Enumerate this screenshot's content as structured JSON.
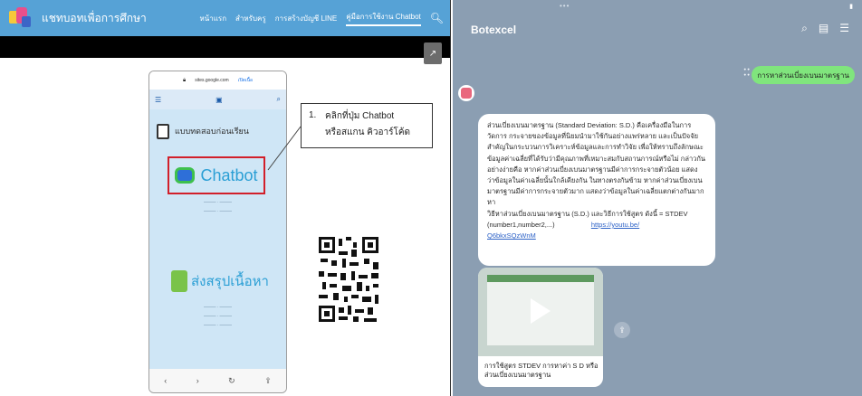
{
  "left": {
    "site": {
      "title": "แชทบอทเพื่อการศึกษา",
      "nav": [
        "หน้าแรก",
        "สำหรับครู",
        "การสร้างบัญชี LINE",
        "คู่มือการใช้งาน Chatbot"
      ],
      "search_icon": "search-icon",
      "open_icon": "external-link-icon"
    },
    "phone": {
      "url": "sites.google.com",
      "open_label": "เปิดเนื้อ",
      "quiz_label": "แบบทดสอบก่อนเรียน",
      "chatbot_label": "Chatbot",
      "summary_label": "ส่งสรุปเนื้อหา"
    },
    "callout": {
      "number": "1.",
      "line1": "คลิกที่ปุ่ม Chatbot",
      "line2": "หรือสแกน คิวอาร์โค้ด"
    }
  },
  "right": {
    "chat_title": "Botexcel",
    "my_message": "การหาส่วนเบี่ยงเบนมาตรฐาน",
    "bot_lines": [
      "ส่วนเบี่ยงเบนมาตรฐาน (Standard Deviation: S.D.) คือเครื่องมือในการ",
      "วัดการ กระจายของข้อมูลที่นิยมนำมาใช้กันอย่างแพร่หลาย และเป็นปัจจัย",
      "สำคัญในกระบวนการวิเคราะห์ข้อมูลและการทำวิจัย เพื่อให้ทราบถึงลักษณะ",
      "ข้อมูลค่าเฉลี่ยที่ได้รับว่ามีคุณภาพที่เหมาะสมกับสถานการณ์หรือไม่ กล่าวกัน",
      "อย่างง่ายคือ หากค่าส่วนเบี่ยงเบนมาตรฐานมีค่าการกระจายตัวน้อย แสดง",
      "ว่าข้อมูลในค่าเฉลี่ยนั้นใกล้เคียงกัน ในทางตรงกันข้าม หากค่าส่วนเบี่ยงเบน",
      "มาตรฐานมีค่าการกระจายตัวมาก แสดงว่าข้อมูลในค่าเฉลี่ยแตกต่างกันมาก",
      "หา",
      "วิธีหาส่วนเบี่ยงเบนมาตรฐาน (S.D.) และวิธีการใช้สูตร ดังนี้ = STDEV"
    ],
    "bot_formula": "(number1,number2,...)",
    "bot_link": "https://youtu.be/",
    "bot_link2": "Q6bkxSQzWnM",
    "video_title": "การใช้สูตร STDEV การหาค่า S D หรือส่วนเบี่ยงเบนมาตรฐาน"
  }
}
